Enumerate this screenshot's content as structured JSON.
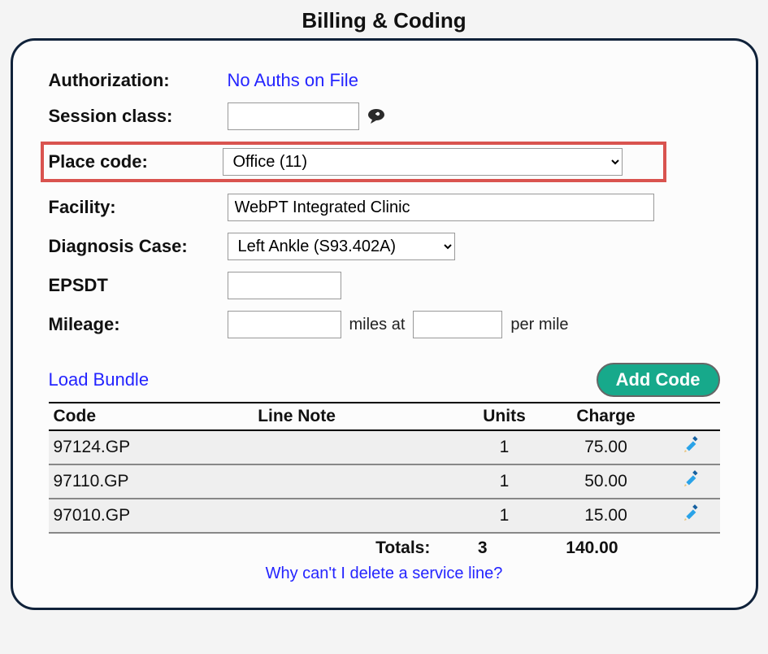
{
  "title": "Billing & Coding",
  "fields": {
    "authorization_label": "Authorization:",
    "authorization_value": "No Auths on File",
    "session_class_label": "Session class:",
    "session_class_value": "",
    "place_code_label": "Place code:",
    "place_code_value": "Office (11)",
    "facility_label": "Facility:",
    "facility_value": "WebPT Integrated Clinic",
    "diagnosis_label": "Diagnosis Case:",
    "diagnosis_value": "Left Ankle (S93.402A)",
    "epsdt_label": "EPSDT",
    "epsdt_value": "",
    "mileage_label": "Mileage:",
    "mileage_miles": "",
    "mileage_miles_at": "miles at",
    "mileage_permile_value": "",
    "mileage_permile": "per mile"
  },
  "actions": {
    "load_bundle": "Load Bundle",
    "add_code": "Add Code"
  },
  "table": {
    "headers": {
      "code": "Code",
      "note": "Line Note",
      "units": "Units",
      "charge": "Charge"
    },
    "rows": [
      {
        "code": "97124.GP",
        "note": "",
        "units": "1",
        "charge": "75.00"
      },
      {
        "code": "97110.GP",
        "note": "",
        "units": "1",
        "charge": "50.00"
      },
      {
        "code": "97010.GP",
        "note": "",
        "units": "1",
        "charge": "15.00"
      }
    ],
    "totals_label": "Totals:",
    "totals_units": "3",
    "totals_charge": "140.00"
  },
  "delete_link": "Why can't I delete a service line?"
}
